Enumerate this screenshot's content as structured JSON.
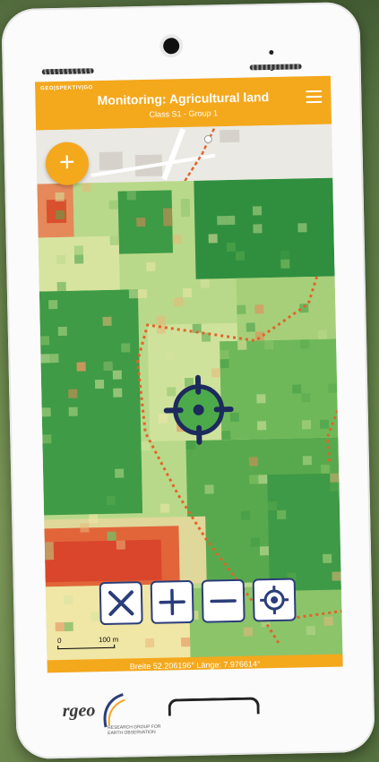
{
  "header": {
    "brand": "GEO|SPEKTIV|GO",
    "title": "Monitoring: Agricultural land",
    "subtitle": "Class S1 - Group 1"
  },
  "add_button": {
    "label": "+"
  },
  "scale": {
    "zero": "0",
    "distance": "100 m"
  },
  "footer": {
    "coordinates": "Breite 52.206196° Länge: 7.976614°"
  },
  "controls": {
    "fullscreen": "fullscreen-toggle",
    "zoom_in": "+",
    "zoom_out": "−",
    "locate": "locate"
  },
  "logo": {
    "name": "rgeo",
    "tagline": "RESEARCH GROUP FOR EARTH OBSERVATION"
  },
  "colors": {
    "accent": "#f4a81c",
    "control_border": "#2b3d7a",
    "trail": "#e0642a"
  }
}
